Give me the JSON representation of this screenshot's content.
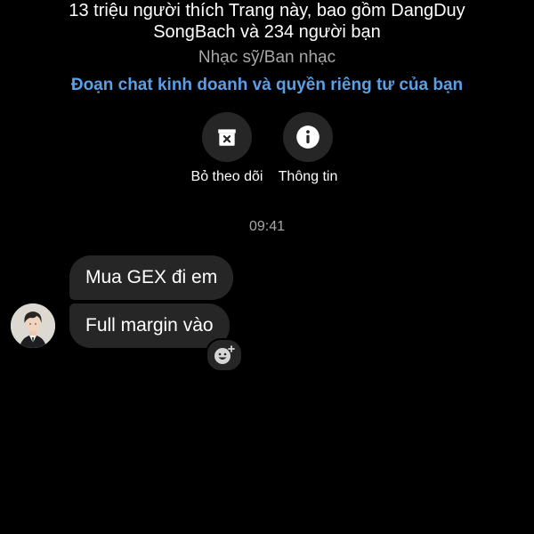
{
  "page_info": {
    "likes_line_1": "13 triệu người thích Trang này, bao gồm DangDuy",
    "likes_line_2": "SongBach và 234 người bạn",
    "category": "Nhạc sỹ/Ban nhạc",
    "privacy_link": "Đoạn chat kinh doanh và quyền riêng tư của bạn"
  },
  "actions": [
    {
      "label": "Bỏ theo dõi",
      "icon": "unfollow-box-x-icon"
    },
    {
      "label": "Thông tin",
      "icon": "info-icon"
    }
  ],
  "conversation": {
    "timestamp": "09:41",
    "messages": [
      {
        "text": "Mua GEX đi em"
      },
      {
        "text": "Full margin vào"
      }
    ],
    "avatar_icon": "profile-avatar",
    "react_icon": "add-reaction-smiley-icon"
  },
  "colors": {
    "background": "#000000",
    "bubble": "#262626",
    "link": "#5b9fe6",
    "secondary_text": "#a8a8a8"
  }
}
